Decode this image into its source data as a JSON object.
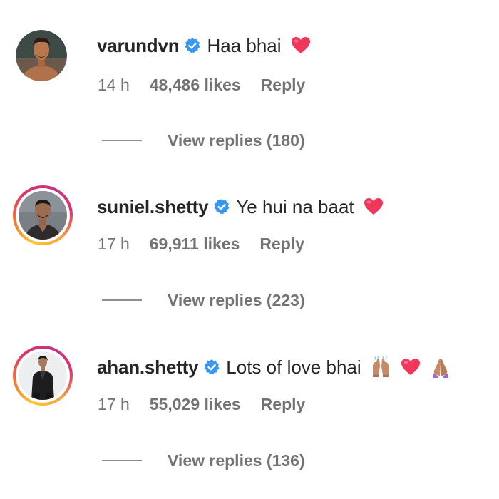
{
  "comments": [
    {
      "username": "varundvn",
      "verified": true,
      "text": "Haa bhai",
      "emojis": [
        "red-heart-icon"
      ],
      "time": "14 h",
      "likes": "48,486 likes",
      "reply_label": "Reply",
      "view_replies": "View replies (180)",
      "has_story_ring": false
    },
    {
      "username": "suniel.shetty",
      "verified": true,
      "text": "Ye hui na baat",
      "emojis": [
        "red-heart-icon"
      ],
      "time": "17 h",
      "likes": "69,911 likes",
      "reply_label": "Reply",
      "view_replies": "View replies (223)",
      "has_story_ring": true
    },
    {
      "username": "ahan.shetty",
      "verified": true,
      "text": "Lots of love bhai",
      "emojis": [
        "raised-hands-icon",
        "red-heart-icon",
        "folded-hands-icon"
      ],
      "time": "17 h",
      "likes": "55,029 likes",
      "reply_label": "Reply",
      "view_replies": "View replies (136)",
      "has_story_ring": true
    }
  ],
  "colors": {
    "verified_badge": "#3897f0",
    "heart": "#f0365a",
    "meta_text": "#737373",
    "primary_text": "#262626",
    "story_ring": [
      "#fdc830",
      "#f37335",
      "#e1306c",
      "#c13584"
    ]
  }
}
